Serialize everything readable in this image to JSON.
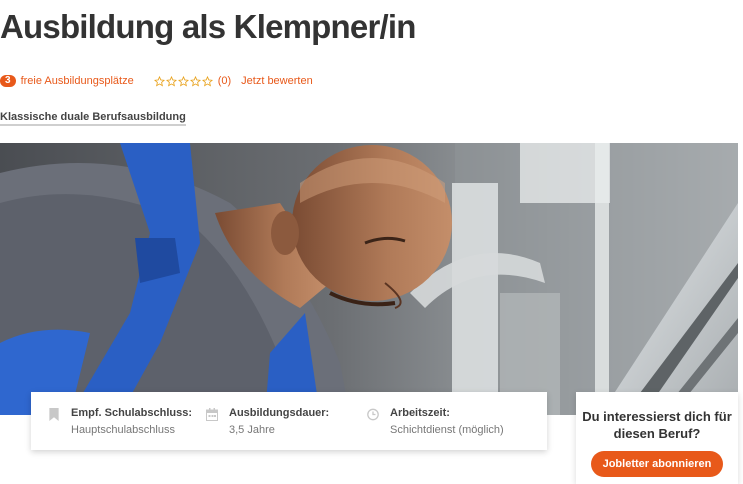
{
  "page": {
    "title": "Ausbildung als Klempner/in",
    "subtitle": "Klassische duale Berufsausbildung"
  },
  "meta": {
    "open_positions_count": "3",
    "open_positions_label": "freie Ausbildungsplätze",
    "rating_stars": 0,
    "rating_max": 5,
    "rating_count": "(0)",
    "rate_link": "Jetzt bewerten"
  },
  "hero_image": {
    "description_icon": "photo-plumber"
  },
  "info": {
    "items": [
      {
        "label": "Empf. Schulabschluss:",
        "value": "Hauptschulabschluss",
        "icon": "bookmark-icon"
      },
      {
        "label": "Ausbildungsdauer:",
        "value": "3,5 Jahre",
        "icon": "calendar-icon"
      },
      {
        "label": "Arbeitszeit:",
        "value": "Schichtdienst (möglich)",
        "icon": "clock-icon"
      }
    ]
  },
  "cta": {
    "question": "Du interessierst dich für diesen Beruf?",
    "button_label": "Jobletter abonnieren"
  },
  "colors": {
    "accent": "#e8591a",
    "title": "#333333",
    "overall_blue": "#2a5fc4"
  }
}
